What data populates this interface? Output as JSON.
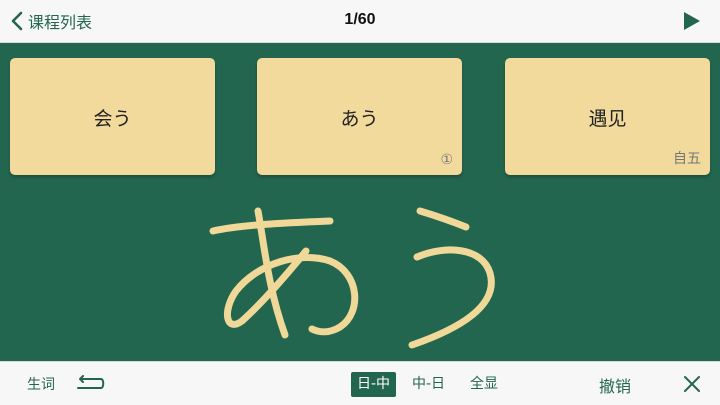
{
  "nav": {
    "back_label": "课程列表",
    "counter": "1/60"
  },
  "cards": [
    {
      "text": "会う",
      "note": ""
    },
    {
      "text": "あう",
      "note": "①"
    },
    {
      "text": "遇见",
      "note": "自五"
    }
  ],
  "toolbar": {
    "vocab_label": "生词",
    "modes": [
      {
        "label": "日-中",
        "active": true
      },
      {
        "label": "中-日",
        "active": false
      },
      {
        "label": "全显",
        "active": false
      }
    ],
    "undo_label": "撤销"
  },
  "colors": {
    "accent": "#23664f",
    "card": "#f1da9c",
    "ink": "#f0d898",
    "bar": "#f7f7f7"
  },
  "icons": {
    "back": "chevron-left-icon",
    "play": "play-icon",
    "swap": "swap-icon",
    "close": "close-icon"
  }
}
